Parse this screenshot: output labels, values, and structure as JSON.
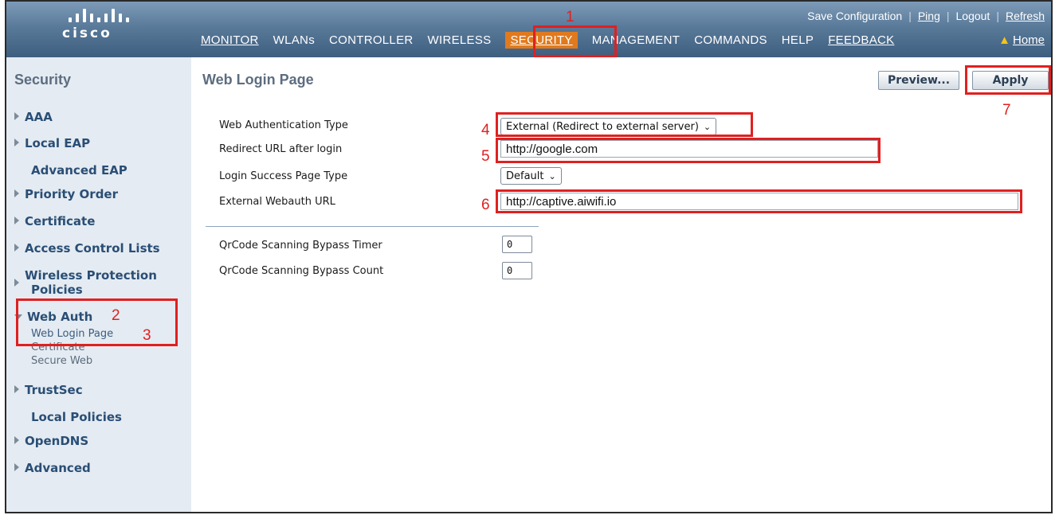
{
  "header": {
    "brand": "cisco",
    "util_links": [
      "Save Configuration",
      "Ping",
      "Logout",
      "Refresh"
    ],
    "nav": [
      "MONITOR",
      "WLANs",
      "CONTROLLER",
      "WIRELESS",
      "SECURITY",
      "MANAGEMENT",
      "COMMANDS",
      "HELP",
      "FEEDBACK"
    ],
    "active_nav": "SECURITY",
    "home_label": "Home",
    "home_icon": "home-icon"
  },
  "sidebar": {
    "title": "Security",
    "items": [
      {
        "label": "AAA",
        "arrow": true
      },
      {
        "label": "Local EAP",
        "arrow": true
      },
      {
        "label": "Advanced EAP",
        "arrow": false
      },
      {
        "label": "Priority Order",
        "arrow": true
      },
      {
        "label": "Certificate",
        "arrow": true
      },
      {
        "label": "Access Control Lists",
        "arrow": true
      },
      {
        "label": "Wireless Protection",
        "arrow": true
      },
      {
        "label": "Policies",
        "arrow": false
      },
      {
        "label": "Web Auth",
        "arrow": true,
        "expanded": true
      },
      {
        "label": "TrustSec",
        "arrow": true
      },
      {
        "label": "Local Policies",
        "arrow": false
      },
      {
        "label": "OpenDNS",
        "arrow": true
      },
      {
        "label": "Advanced",
        "arrow": true
      }
    ],
    "web_auth_sub": [
      "Web Login Page",
      "Certificate",
      "Secure Web"
    ]
  },
  "main": {
    "title": "Web Login Page",
    "preview_label": "Preview...",
    "apply_label": "Apply",
    "fields": {
      "auth_type_label": "Web Authentication Type",
      "auth_type_value": "External (Redirect to external server)",
      "redirect_label": "Redirect URL after login",
      "redirect_value": "http://google.com",
      "success_label": "Login Success Page Type",
      "success_value": "Default",
      "external_label": "External Webauth URL",
      "external_value": "http://captive.aiwifi.io",
      "qr_timer_label": "QrCode Scanning Bypass Timer",
      "qr_timer_value": "0",
      "qr_count_label": "QrCode Scanning Bypass Count",
      "qr_count_value": "0"
    }
  },
  "annotations": [
    "1",
    "2",
    "3",
    "4",
    "5",
    "6",
    "7"
  ],
  "colors": {
    "annotation": "#e02020",
    "header_accent": "#e07a1e",
    "link": "#2a4e75"
  }
}
